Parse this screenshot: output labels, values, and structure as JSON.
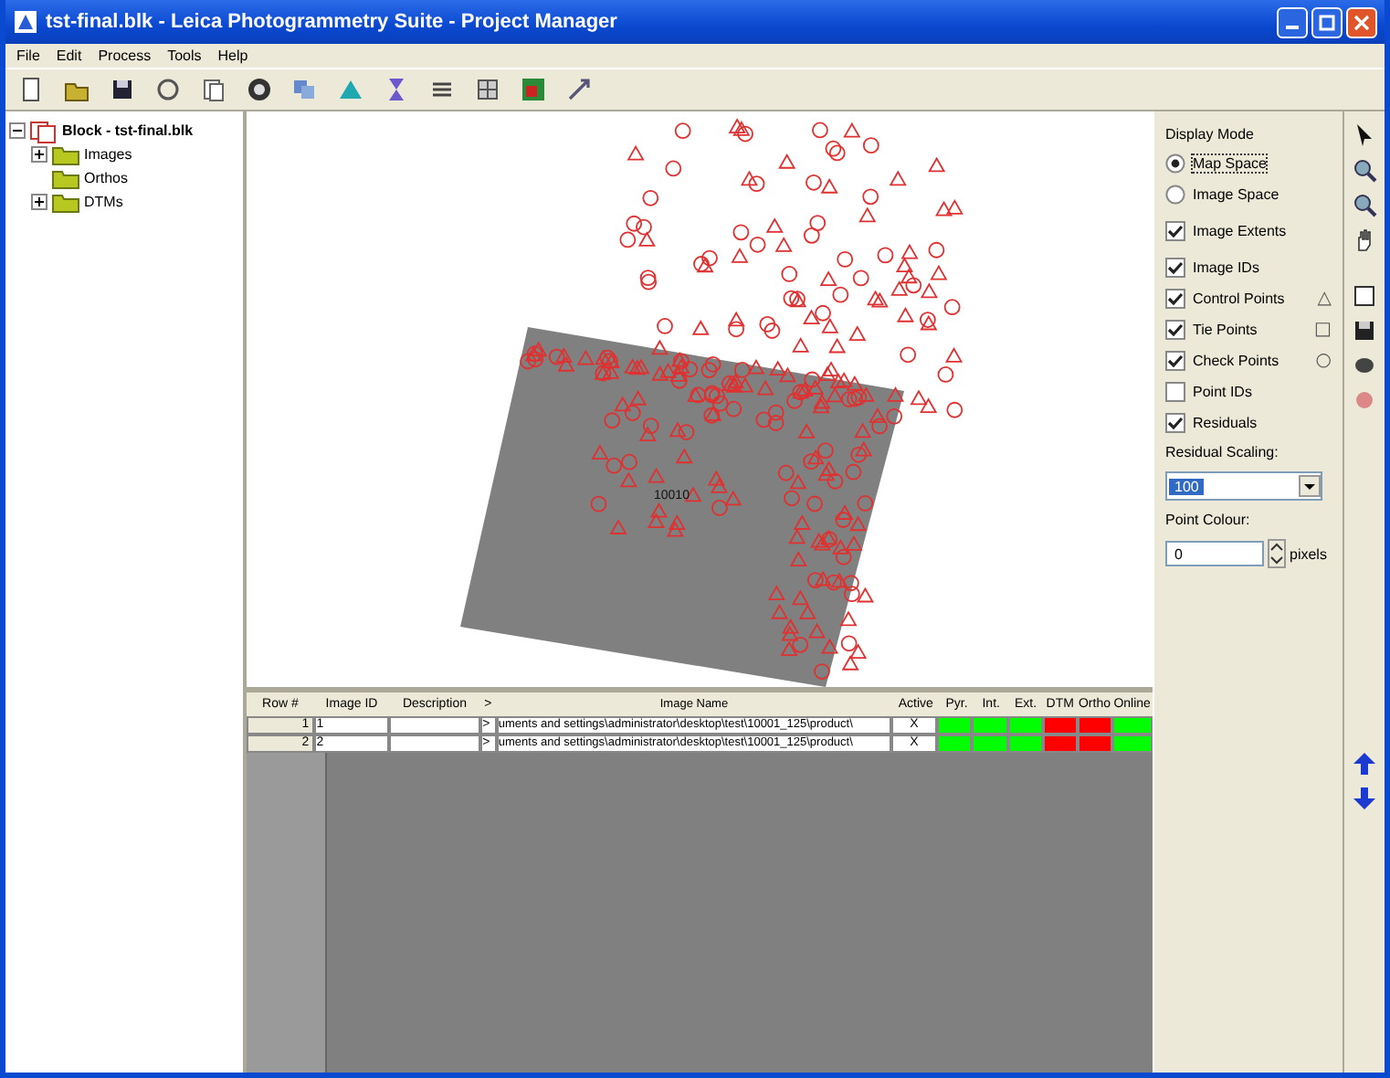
{
  "window": {
    "title": "tst-final.blk - Leica Photogrammetry Suite - Project Manager"
  },
  "menu": [
    "File",
    "Edit",
    "Process",
    "Tools",
    "Help"
  ],
  "tree": {
    "label": "Block - tst-final.blk",
    "expanded": true,
    "children": [
      {
        "label": "Images",
        "expanded": false
      },
      {
        "label": "Orthos"
      },
      {
        "label": "DTMs",
        "expanded": false
      }
    ]
  },
  "map": {
    "image_label": "10010"
  },
  "display": {
    "title": "Display Mode",
    "options": [
      {
        "kind": "radio",
        "label": "Map Space",
        "selected": true
      },
      {
        "kind": "radio",
        "label": "Image Space",
        "selected": false
      },
      {
        "kind": "check",
        "label": "Image Extents",
        "checked": true
      },
      {
        "kind": "check",
        "label": "Image IDs",
        "checked": true
      },
      {
        "kind": "check",
        "label": "Control Points",
        "checked": true,
        "symbol": "△"
      },
      {
        "kind": "check",
        "label": "Tie Points",
        "checked": true,
        "symbol": "□"
      },
      {
        "kind": "check",
        "label": "Check Points",
        "checked": true,
        "symbol": "○"
      },
      {
        "kind": "check",
        "label": "Point IDs",
        "checked": false
      },
      {
        "kind": "check",
        "label": "Residuals",
        "checked": true
      }
    ],
    "scaling_label": "Residual Scaling:",
    "scaling_value": "100",
    "colour_label": "Point Colour:",
    "colour_value": "0",
    "colour_unit": "pixels"
  },
  "table": {
    "columns": [
      "Row #",
      "Image ID",
      "Description",
      ">",
      "Image Name",
      "Active",
      "Pyr.",
      "Int.",
      "Ext.",
      "DTM",
      "Ortho",
      "Online"
    ],
    "rows": [
      {
        "row": "1",
        "image_id": "1",
        "description": "",
        "marker": ">",
        "image_name": "uments and settings\\administrator\\desktop\\test\\10001_125\\product\\",
        "active": "X",
        "status": [
          {
            "color": "#00ff00"
          },
          {
            "color": "#00ff00"
          },
          {
            "color": "#00ff00"
          },
          {
            "color": "#ff0000"
          },
          {
            "color": "#ff0000"
          },
          {
            "color": "#00ff00"
          }
        ]
      },
      {
        "row": "2",
        "image_id": "2",
        "description": "",
        "marker": ">",
        "image_name": "uments and settings\\administrator\\desktop\\test\\10001_125\\product\\",
        "active": "X",
        "status": [
          {
            "color": "#00ff00"
          },
          {
            "color": "#00ff00"
          },
          {
            "color": "#00ff00"
          },
          {
            "color": "#ff0000"
          },
          {
            "color": "#ff0000"
          },
          {
            "color": "#00ff00"
          }
        ]
      }
    ]
  }
}
